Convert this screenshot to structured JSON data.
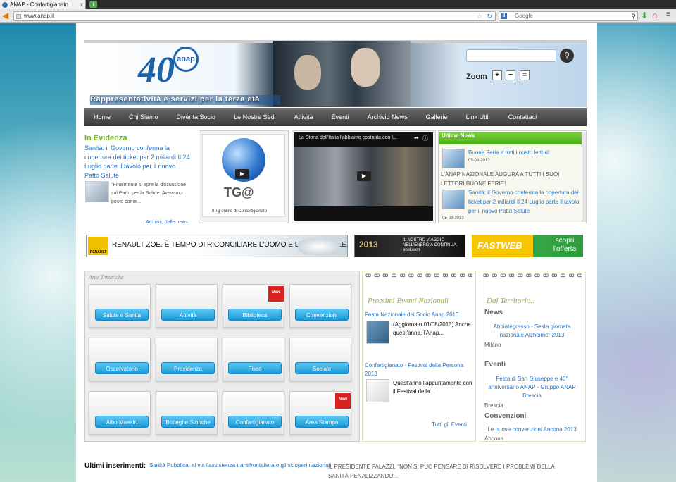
{
  "browser": {
    "tab_title": "ANAP - Confartigianato",
    "tab_close": "x",
    "new_tab": "+",
    "url": "www.anap.it",
    "search_placeholder": "Google",
    "search_engine_glyph": "8"
  },
  "header": {
    "logo_number": "40",
    "logo_at": "anap",
    "tagline": "Rappresentatività e servizi per la terza età",
    "zoom_label": "Zoom",
    "zoom_plus": "+",
    "zoom_minus": "−",
    "zoom_reset": "="
  },
  "nav": [
    "Home",
    "Chi Siamo",
    "Diventa Socio",
    "Le Nostre Sedi",
    "Attività",
    "Eventi",
    "Archivio News",
    "Gallerie",
    "Link Utili",
    "Contattaci"
  ],
  "evidenza": {
    "title": "In Evidenza",
    "headline": "Sanità: il Governo conferma la copertura dei ticket per 2 miliardi Il 24 Luglio parte il tavolo per il nuovo Patto Salute",
    "excerpt": "\"Finalmente si apre la discussione sul Patto per la Salute. Avevamo posto come...",
    "archive_link": "Archivio delle news"
  },
  "tg": {
    "title": "TG@",
    "subtitle": "Il Tg online di Confartigianato"
  },
  "video": {
    "title": "La Storia dell'Italia l'abbiamo costruita con l..."
  },
  "ultime_news": {
    "heading": "Ultime News",
    "items": [
      {
        "title": "Buone Ferie a tutti i nostri lettori!",
        "date": "05-08-2013"
      },
      {
        "title": "L'ANAP NAZIONALE AUGURA A TUTTI I SUOI LETTORI BUONE FERIE!",
        "date": ""
      },
      {
        "title": "Sanità: il Governo conferma la copertura dei ticket per 2 miliardi Il 24 Luglio parte il tavolo per il nuovo Patto Salute",
        "date": "05-08-2013"
      }
    ]
  },
  "banners": {
    "renault_brand": "RENAULT",
    "renault_text": "RENAULT ZOE. È TEMPO DI RICONCILIARE L'UOMO E L'AUTOMOBILE.",
    "enel_year": "2013",
    "enel_text": "IL NOSTRO VIAGGIO NELL'ENERGIA CONTINUA. enel.com",
    "fastweb_brand": "FASTWEB",
    "fastweb_cta": "scopri l'offerta"
  },
  "aree": {
    "title": "Aree Tematiche",
    "new_tag": "New",
    "items": [
      "Salute e Sanità",
      "Attività",
      "Biblioteca",
      "Convenzioni",
      "Osservatorio",
      "Previdenza",
      "Fisco",
      "Sociale",
      "Albo Maestri",
      "Botteghe Storiche",
      "Confartigianato",
      "Area Stampa"
    ]
  },
  "eventi_nazionali": {
    "rings": "ꝏꝏꝏꝏꝏꝏꝏꝏꝏꝏꝏꝏꝏꝏ",
    "heading": "Prossimi Eventi Nazionali",
    "items": [
      {
        "title": "Festa Nazionale dei Socio Anap 2013",
        "text": "(Aggiornato 01/08/2013) Anche quest'anno, l'Anap..."
      },
      {
        "title": "Confartigianato - Festival della Persona 2013",
        "text": "Quest'anno l'appuntamento con il Festival della..."
      }
    ],
    "all_link": "Tutti gli Eventi"
  },
  "territorio": {
    "rings": "ꝏꝏꝏꝏꝏꝏꝏꝏꝏꝏꝏꝏꝏ",
    "heading": "Dal Territorio..",
    "sections": [
      {
        "name": "News",
        "link": "Abbiategrasso - Sesta giornata nazionale Alzheimer 2013",
        "location": "Milano"
      },
      {
        "name": "Eventi",
        "link": "Festa di San Giuseppe e 40° anniversario ANAP - Gruppo ANAP Brescia",
        "location": "Brescia"
      },
      {
        "name": "Convenzioni",
        "link": "Le nuove convenzioni Ancona 2013",
        "location": "Ancona"
      }
    ]
  },
  "ultimi": {
    "label": "Ultimi inserimenti:",
    "link": "Sanità Pubblica: al via l'assistenza transfrontaliera e gli scioperi nazionali",
    "text": "IL PRESIDENTE PALAZZI, \"NON SI PUÒ PENSARE DI RISOLVERE I PROBLEMI DELLA SANITÀ PENALIZZANDO..."
  },
  "colors": {
    "accent_green": "#6bb516",
    "link_blue": "#2a73bd",
    "button_blue": "#1a9ad8",
    "nav_dark": "#3a3a3a"
  }
}
